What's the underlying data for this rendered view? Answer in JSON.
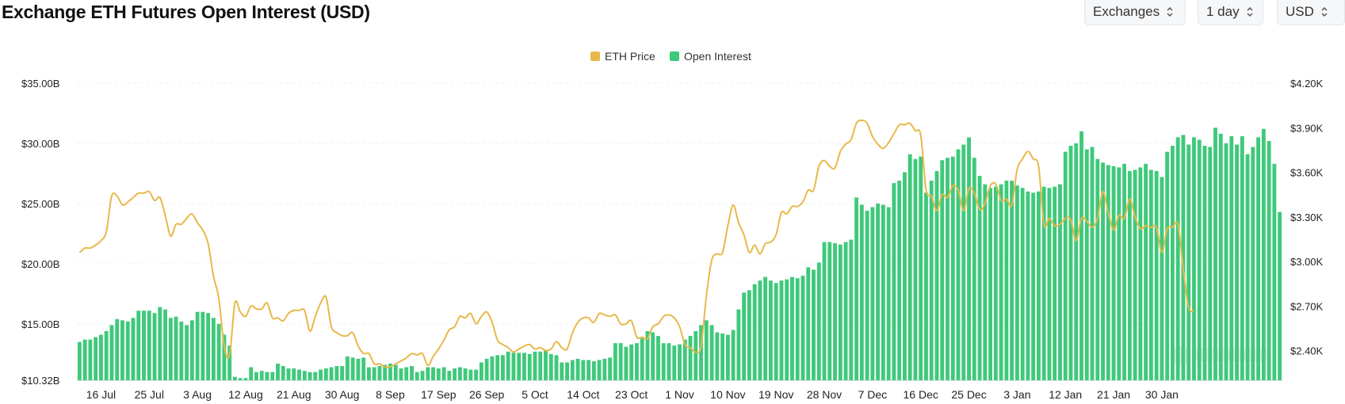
{
  "header": {
    "title": "Exchange ETH Futures Open Interest (USD)",
    "exchanges_select": "Exchanges",
    "interval_select": "1 day",
    "currency_select": "USD"
  },
  "colors": {
    "price": "#e8b84a",
    "oi": "#3ec97a",
    "grid": "#eef0f3"
  },
  "chart_data": {
    "type": "bar+line",
    "legend": [
      "ETH Price",
      "Open Interest"
    ],
    "y_left_ticks": [
      "$35.00B",
      "$30.00B",
      "$25.00B",
      "$20.00B",
      "$15.00B",
      "$10.32B"
    ],
    "y_left_range": [
      10.32,
      35.0
    ],
    "y_right_ticks": [
      "$4.20K",
      "$3.90K",
      "$3.60K",
      "$3.30K",
      "$3.00K",
      "$2.70K",
      "$2.40K"
    ],
    "y_right_range": [
      2200,
      4200
    ],
    "x_ticks": [
      "16 Jul",
      "25 Jul",
      "3 Aug",
      "12 Aug",
      "21 Aug",
      "30 Aug",
      "8 Sep",
      "17 Sep",
      "26 Sep",
      "5 Oct",
      "14 Oct",
      "23 Oct",
      "1 Nov",
      "10 Nov",
      "19 Nov",
      "28 Nov",
      "7 Dec",
      "16 Dec",
      "25 Dec",
      "3 Jan",
      "12 Jan",
      "21 Jan",
      "30 Jan"
    ],
    "x_tick_index": [
      4,
      13,
      22,
      31,
      40,
      49,
      58,
      67,
      76,
      85,
      94,
      103,
      112,
      121,
      130,
      139,
      148,
      157,
      166,
      175,
      184,
      193,
      202
    ],
    "series": [
      {
        "name": "Open Interest",
        "unit": "B USD",
        "values": [
          13.5,
          13.7,
          13.7,
          13.9,
          14.1,
          14.4,
          14.9,
          15.4,
          15.3,
          15.2,
          15.5,
          16.1,
          16.1,
          16.1,
          15.9,
          16.4,
          16.2,
          15.5,
          15.6,
          15.2,
          14.9,
          15.3,
          16.0,
          16.0,
          15.9,
          15.5,
          15.0,
          14.1,
          13.2,
          10.6,
          10.5,
          10.5,
          11.4,
          11.0,
          11.1,
          11.0,
          11.0,
          11.7,
          11.5,
          11.3,
          11.3,
          11.2,
          11.1,
          11.0,
          11.0,
          11.2,
          11.3,
          11.4,
          11.5,
          11.5,
          12.3,
          12.2,
          12.1,
          12.2,
          11.4,
          11.4,
          11.5,
          11.6,
          11.7,
          11.6,
          11.3,
          11.4,
          11.5,
          11.0,
          11.1,
          11.4,
          11.4,
          11.3,
          11.4,
          11.1,
          11.3,
          11.4,
          11.3,
          11.2,
          11.2,
          11.8,
          12.1,
          12.3,
          12.4,
          12.4,
          12.7,
          12.6,
          12.6,
          12.6,
          12.5,
          12.7,
          12.7,
          12.8,
          12.5,
          12.4,
          11.8,
          11.8,
          12.0,
          12.1,
          12.0,
          12.0,
          11.9,
          12.0,
          12.1,
          12.2,
          13.4,
          13.4,
          13.1,
          13.3,
          13.4,
          13.8,
          14.4,
          14.3,
          14.0,
          13.4,
          13.4,
          13.2,
          13.3,
          13.7,
          14.0,
          14.4,
          14.9,
          15.3,
          14.9,
          14.3,
          14.2,
          14.1,
          14.5,
          16.2,
          17.6,
          17.8,
          18.3,
          18.6,
          18.9,
          18.6,
          18.4,
          18.6,
          18.7,
          18.9,
          18.8,
          19.0,
          19.7,
          19.5,
          20.1,
          21.8,
          21.8,
          21.7,
          21.6,
          21.8,
          22.0,
          25.5,
          24.9,
          24.4,
          24.7,
          25.0,
          24.9,
          24.7,
          26.7,
          26.9,
          27.6,
          29.1,
          28.7,
          28.9,
          25.9,
          26.9,
          27.7,
          28.6,
          28.8,
          28.9,
          29.5,
          29.9,
          30.5,
          28.8,
          27.3,
          26.6,
          26.3,
          26.4,
          26.6,
          26.9,
          26.9,
          26.5,
          26.3,
          26.0,
          25.9,
          26.0,
          26.4,
          26.3,
          26.4,
          26.6,
          29.3,
          29.8,
          30.0,
          31.0,
          29.5,
          29.7,
          28.7,
          28.4,
          28.2,
          28.1,
          28.0,
          28.3,
          27.7,
          27.8,
          28.0,
          28.3,
          27.8,
          27.7,
          27.2,
          29.3,
          29.8,
          30.5,
          30.7,
          29.9,
          30.5,
          30.3,
          29.8,
          29.7,
          31.3,
          30.8,
          30.0,
          30.6,
          29.9,
          30.6,
          29.1,
          29.7,
          30.5,
          31.2,
          30.2,
          28.3,
          24.3
        ]
      },
      {
        "name": "ETH Price",
        "unit": "USD",
        "values": [
          3060,
          3090,
          3090,
          3110,
          3140,
          3200,
          3440,
          3440,
          3380,
          3400,
          3430,
          3460,
          3460,
          3470,
          3410,
          3430,
          3310,
          3170,
          3250,
          3250,
          3290,
          3320,
          3260,
          3210,
          3120,
          2900,
          2750,
          2430,
          2370,
          2720,
          2660,
          2630,
          2700,
          2680,
          2680,
          2720,
          2620,
          2620,
          2600,
          2650,
          2670,
          2670,
          2670,
          2530,
          2630,
          2720,
          2760,
          2560,
          2520,
          2500,
          2500,
          2520,
          2430,
          2380,
          2380,
          2310,
          2310,
          2290,
          2290,
          2310,
          2330,
          2350,
          2380,
          2370,
          2380,
          2300,
          2360,
          2410,
          2470,
          2540,
          2560,
          2630,
          2620,
          2650,
          2580,
          2630,
          2660,
          2590,
          2470,
          2440,
          2420,
          2390,
          2410,
          2430,
          2440,
          2410,
          2420,
          2400,
          2410,
          2460,
          2420,
          2410,
          2520,
          2590,
          2620,
          2620,
          2590,
          2650,
          2640,
          2630,
          2640,
          2580,
          2580,
          2600,
          2490,
          2490,
          2480,
          2560,
          2580,
          2630,
          2640,
          2620,
          2560,
          2440,
          2420,
          2390,
          2430,
          2770,
          3010,
          3050,
          3060,
          3240,
          3380,
          3260,
          3180,
          3060,
          3110,
          3050,
          3120,
          3130,
          3180,
          3330,
          3320,
          3370,
          3370,
          3400,
          3480,
          3480,
          3640,
          3680,
          3640,
          3630,
          3740,
          3790,
          3820,
          3930,
          3950,
          3930,
          3840,
          3790,
          3760,
          3800,
          3860,
          3920,
          3920,
          3930,
          3880,
          3850,
          3480,
          3440,
          3340,
          3450,
          3430,
          3510,
          3480,
          3340,
          3490,
          3460,
          3350,
          3390,
          3510,
          3520,
          3410,
          3420,
          3380,
          3620,
          3690,
          3740,
          3690,
          3640,
          3250,
          3290,
          3240,
          3250,
          3290,
          3280,
          3140,
          3290,
          3270,
          3230,
          3290,
          3470,
          3330,
          3210,
          3310,
          3290,
          3420,
          3300,
          3220,
          3240,
          3230,
          3230,
          3060,
          3220,
          3230,
          3250,
          2950,
          2690,
          2670
        ]
      }
    ],
    "title": "Exchange ETH Futures Open Interest (USD)",
    "grid": "horizontal dashed",
    "legend_position": "top-center"
  }
}
